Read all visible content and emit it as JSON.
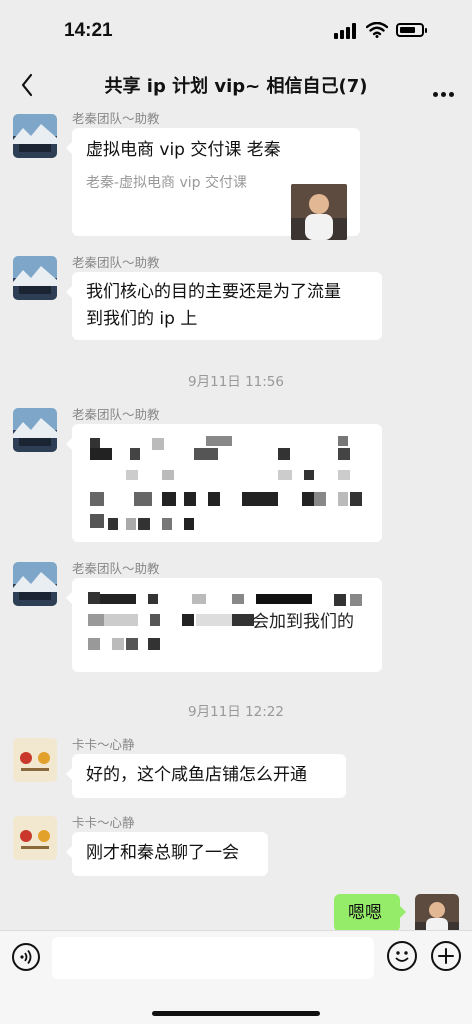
{
  "status": {
    "time": "14:21"
  },
  "nav": {
    "title": "共享 ip 计划 vip~ 相信自己(7)"
  },
  "messages": {
    "m1": {
      "sender": "老秦团队～助教",
      "card_title": "虚拟电商 vip 交付课 老秦",
      "card_sub": "老秦-虚拟电商 vip 交付课"
    },
    "m2": {
      "sender": "老秦团队～助教",
      "line1": "我们核心的目的主要还是为了流量",
      "line2": "到我们的 ip 上"
    },
    "ts1": "9月11日 11:56",
    "m3": {
      "sender": "老秦团队～助教"
    },
    "m4": {
      "sender": "老秦团队～助教",
      "tail": "会加到我们的"
    },
    "ts2": "9月11日 12:22",
    "m5": {
      "sender": "卡卡～心静",
      "text": "好的，这个咸鱼店铺怎么开通"
    },
    "m6": {
      "sender": "卡卡～心静",
      "text": "刚才和秦总聊了一会"
    },
    "m7": {
      "text": "嗯嗯"
    }
  },
  "colors": {
    "bg": "#ededed",
    "bubble_self": "#95ec69",
    "bubble_other": "#ffffff"
  },
  "icons": [
    "back-arrow-icon",
    "more-icon",
    "voice-icon",
    "emoji-icon",
    "plus-icon",
    "signal-icon",
    "wifi-icon",
    "battery-icon"
  ],
  "battery_level": 0.75
}
